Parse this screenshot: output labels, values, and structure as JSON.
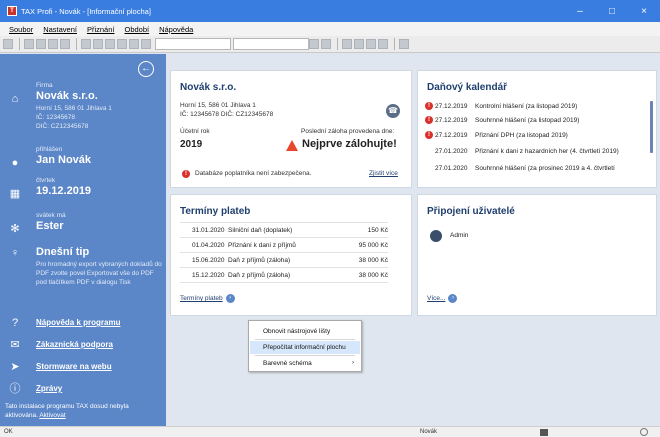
{
  "window": {
    "title": "TAX Profi - Novák - [Informační plocha]",
    "minimize": "–",
    "maximize": "□",
    "close": "×"
  },
  "menu": [
    "Soubor",
    "Nastavení",
    "Přiznání",
    "Období",
    "Nápověda"
  ],
  "sidebar": {
    "back_icon": "←",
    "firm_label": "Firma",
    "firm_name": "Novák s.r.o.",
    "firm_addr": "Horní 15, 586 01 Jihlava 1",
    "firm_ic": "IČ: 12345678",
    "firm_dic": "DIČ: CZ12345678",
    "user_label": "přihlášen",
    "user_name": "Jan Novák",
    "day_label": "čtvrtek",
    "date": "19.12.2019",
    "nameday_label": "svátek má",
    "nameday": "Ester",
    "tip_title": "Dnešní tip",
    "tip_text": "Pro hromadný export vybraných dokladů do PDF zvolte povel Exportovat vše do PDF pod tlačítkem PDF v dialogu Tisk",
    "help_link": "Nápověda k programu",
    "support_link": "Zákaznická podpora",
    "web_link": "Stormware na webu",
    "news_link": "Zprávy",
    "footer_text": "Tato instalace programu TAX dosud nebyla aktivována.",
    "footer_link": "Aktivovat"
  },
  "company_card": {
    "title": "Novák s.r.o.",
    "addr": "Horní 15, 586 01 Jihlava 1",
    "ids": "IČ: 12345678  DIČ: CZ12345678",
    "fiscal_label": "Účetní rok",
    "fiscal_year": "2019",
    "backup_label": "Poslední záloha provedena dne:",
    "backup_warning": "Nejprve zálohujte!",
    "db_status": "Databáze poplatníka není zabezpečena.",
    "more_link": "Zjistit více"
  },
  "calendar": {
    "title": "Daňový kalendář",
    "rows": [
      {
        "date": "27.12.2019",
        "text": "Kontrolní hlášení (za listopad 2019)",
        "alert": true
      },
      {
        "date": "27.12.2019",
        "text": "Souhrnné hlášení (za listopad 2019)",
        "alert": true
      },
      {
        "date": "27.12.2019",
        "text": "Přiznání DPH (za listopad 2019)",
        "alert": true
      },
      {
        "date": "27.01.2020",
        "text": "Přiznání k dani z hazardních her (4. čtvrtletí 2019)",
        "alert": false
      },
      {
        "date": "27.01.2020",
        "text": "Souhrnné hlášení (za prosinec 2019 a 4. čtvrtletí",
        "alert": false
      }
    ]
  },
  "payments": {
    "title": "Termíny plateb",
    "rows": [
      {
        "date": "31.01.2020",
        "name": "Silniční daň (doplatek)",
        "amount": "150 Kč"
      },
      {
        "date": "01.04.2020",
        "name": "Přiznání k dani z příjmů",
        "amount": "95 000 Kč"
      },
      {
        "date": "15.06.2020",
        "name": "Daň z příjmů (záloha)",
        "amount": "38 000 Kč"
      },
      {
        "date": "15.12.2020",
        "name": "Daň z příjmů (záloha)",
        "amount": "38 000 Kč"
      }
    ],
    "link": "Termíny plateb"
  },
  "users": {
    "title": "Připojení uživatelé",
    "user": "Admin",
    "link": "Více..."
  },
  "context_menu": {
    "items": [
      "Obnovit nástrojové lišty",
      "Přepočítat informační plochu",
      "Barevné schéma"
    ],
    "submenu_arrow": "›"
  },
  "statusbar": {
    "left": "OK",
    "mid": "Novák"
  }
}
